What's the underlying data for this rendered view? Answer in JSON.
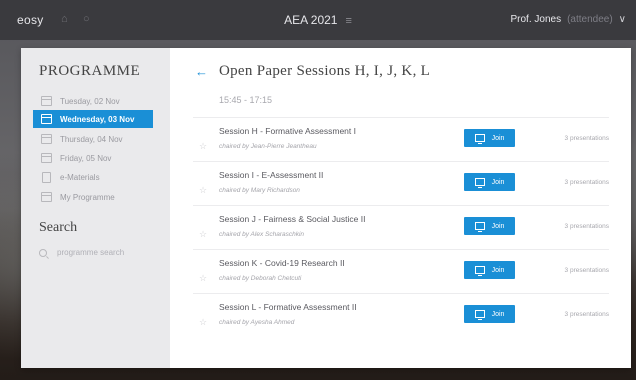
{
  "topbar": {
    "logo": "eosy",
    "conference_title": "AEA 2021",
    "menu_glyph": "≡",
    "user_name": "Prof. Jones",
    "user_role": "(attendee)",
    "caret": "∨"
  },
  "sidebar": {
    "programme_title": "PROGRAMME",
    "items": [
      {
        "label": "Tuesday, 02 Nov",
        "icon": "calendar-icon",
        "active": false
      },
      {
        "label": "Wednesday, 03 Nov",
        "icon": "calendar-icon",
        "active": true
      },
      {
        "label": "Thursday, 04 Nov",
        "icon": "calendar-icon",
        "active": false
      },
      {
        "label": "Friday, 05 Nov",
        "icon": "calendar-icon",
        "active": false
      },
      {
        "label": "e-Materials",
        "icon": "materials-icon",
        "active": false
      },
      {
        "label": "My Programme",
        "icon": "calendar-icon",
        "active": false
      }
    ],
    "search_title": "Search",
    "search_placeholder": "programme search"
  },
  "main": {
    "back_glyph": "←",
    "title": "Open Paper Sessions H, I, J, K, L",
    "time": "15:45 - 17:15",
    "join_label": "Join",
    "sessions": [
      {
        "name": "Session H - Formative Assessment I",
        "chair": "chaired by Jean-Pierre Jeantheau",
        "presentations": "3 presentations"
      },
      {
        "name": "Session I - E-Assessment II",
        "chair": "chaired by Mary Richardson",
        "presentations": "3 presentations"
      },
      {
        "name": "Session J - Fairness & Social Justice II",
        "chair": "chaired by Alex Scharaschkin",
        "presentations": "3 presentations"
      },
      {
        "name": "Session K - Covid-19 Research II",
        "chair": "chaired by Deborah Chetcuti",
        "presentations": "3 presentations"
      },
      {
        "name": "Session L - Formative Assessment II",
        "chair": "chaired by Ayesha Ahmed",
        "presentations": "3 presentations"
      }
    ]
  },
  "colors": {
    "accent": "#1a8fd6",
    "sidebar_bg": "#eaeaec",
    "topbar_bg": "#3a3a3e"
  }
}
